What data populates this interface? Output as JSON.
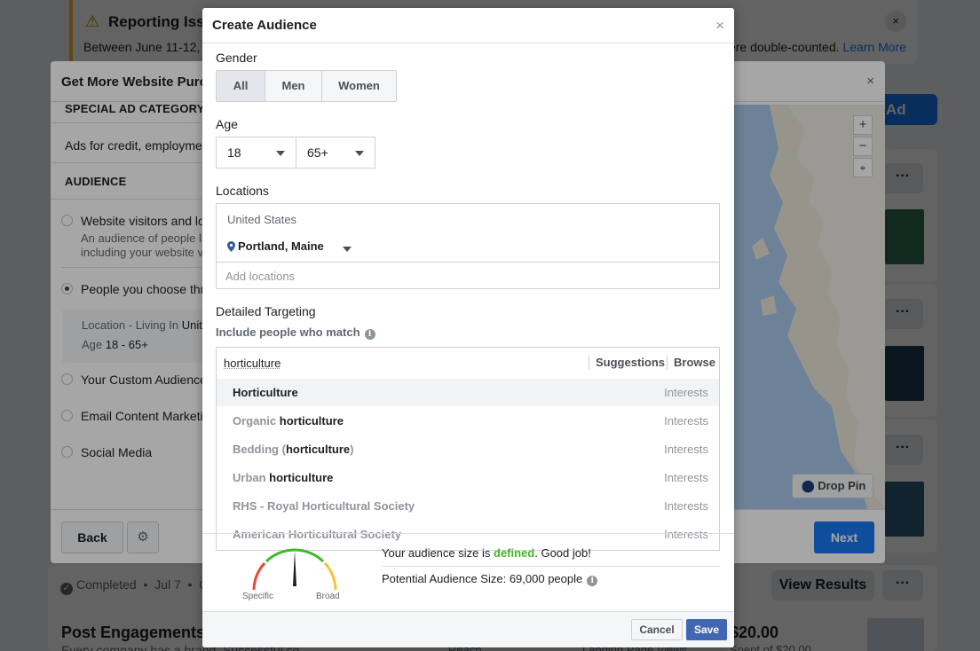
{
  "background": {
    "banner": {
      "title": "Reporting Issue",
      "text": "Between June 11-12, 2",
      "text_right": "ere double-counted.",
      "learn_more": "Learn More",
      "close": "×"
    },
    "create_ad_button": "Ad",
    "more": "···",
    "completed_status": "Completed",
    "completed_date": "Jul 7",
    "completed_more": "C",
    "view_results": "View Results",
    "post_title": "Post Engagements",
    "post_subtitle": "Every company has a brand. Successful co",
    "col_reach": "Reach",
    "col_landing": "Landing Page Views",
    "money": "$20.00",
    "money_sub": "Spent of $20.00"
  },
  "mid_modal": {
    "title": "Get More Website Purch",
    "close": "×",
    "special_ad_category_header": "SPECIAL AD CATEGORY",
    "special_ad_text": "Ads for credit, employmen",
    "audience_header": "AUDIENCE",
    "options": [
      {
        "label": "Website visitors and look",
        "sub1": "An audience of people li",
        "sub2": "including your website v"
      },
      {
        "label": "People you choose throu"
      },
      {
        "label": "Your Custom Audiences"
      },
      {
        "label": "Email Content Marketing"
      },
      {
        "label": "Social Media"
      }
    ],
    "summary_location_label": "Location - Living In",
    "summary_location_value": "Unit",
    "summary_age_label": "Age",
    "summary_age_value": "18 - 65+",
    "back": "Back",
    "next": "Next",
    "drop_pin": "Drop Pin",
    "zoom_in": "+",
    "zoom_out": "−"
  },
  "dialog": {
    "title": "Create Audience",
    "close": "×",
    "gender_label": "Gender",
    "gender_options": [
      "All",
      "Men",
      "Women"
    ],
    "gender_selected": "All",
    "age_label": "Age",
    "age_min": "18",
    "age_max": "65+",
    "locations_label": "Locations",
    "location_country": "United States",
    "location_city": "Portland, Maine",
    "add_locations_placeholder": "Add locations",
    "detailed_targeting_label": "Detailed Targeting",
    "include_label": "Include people who match",
    "search_value": "horticulture",
    "suggestions": "Suggestions",
    "browse": "Browse",
    "results": [
      {
        "prefix": "",
        "match": "Horticulture",
        "suffix": "",
        "type": "Interests",
        "highlighted": true
      },
      {
        "prefix": "Organic ",
        "match": "horticulture",
        "suffix": "",
        "type": "Interests"
      },
      {
        "prefix": "Bedding (",
        "match": "horticulture",
        "suffix": ")",
        "type": "Interests"
      },
      {
        "prefix": "Urban ",
        "match": "horticulture",
        "suffix": "",
        "type": "Interests"
      },
      {
        "prefix": "RHS - Royal Horticultural Society",
        "match": "",
        "suffix": "",
        "type": "Interests"
      },
      {
        "prefix": "American Horticultural Society",
        "match": "",
        "suffix": "",
        "type": "Interests"
      }
    ],
    "gauge_specific": "Specific",
    "gauge_broad": "Broad",
    "audience_defined_pre": "Your audience size is ",
    "audience_defined_word": "defined",
    "audience_defined_post": ". Good job!",
    "potential_size": "Potential Audience Size: 69,000 people",
    "cancel": "Cancel",
    "save": "Save"
  },
  "colors": {
    "primary": "#1877f2",
    "save": "#4267b2",
    "defined_green": "#42b72a",
    "warning": "#f7b928"
  }
}
